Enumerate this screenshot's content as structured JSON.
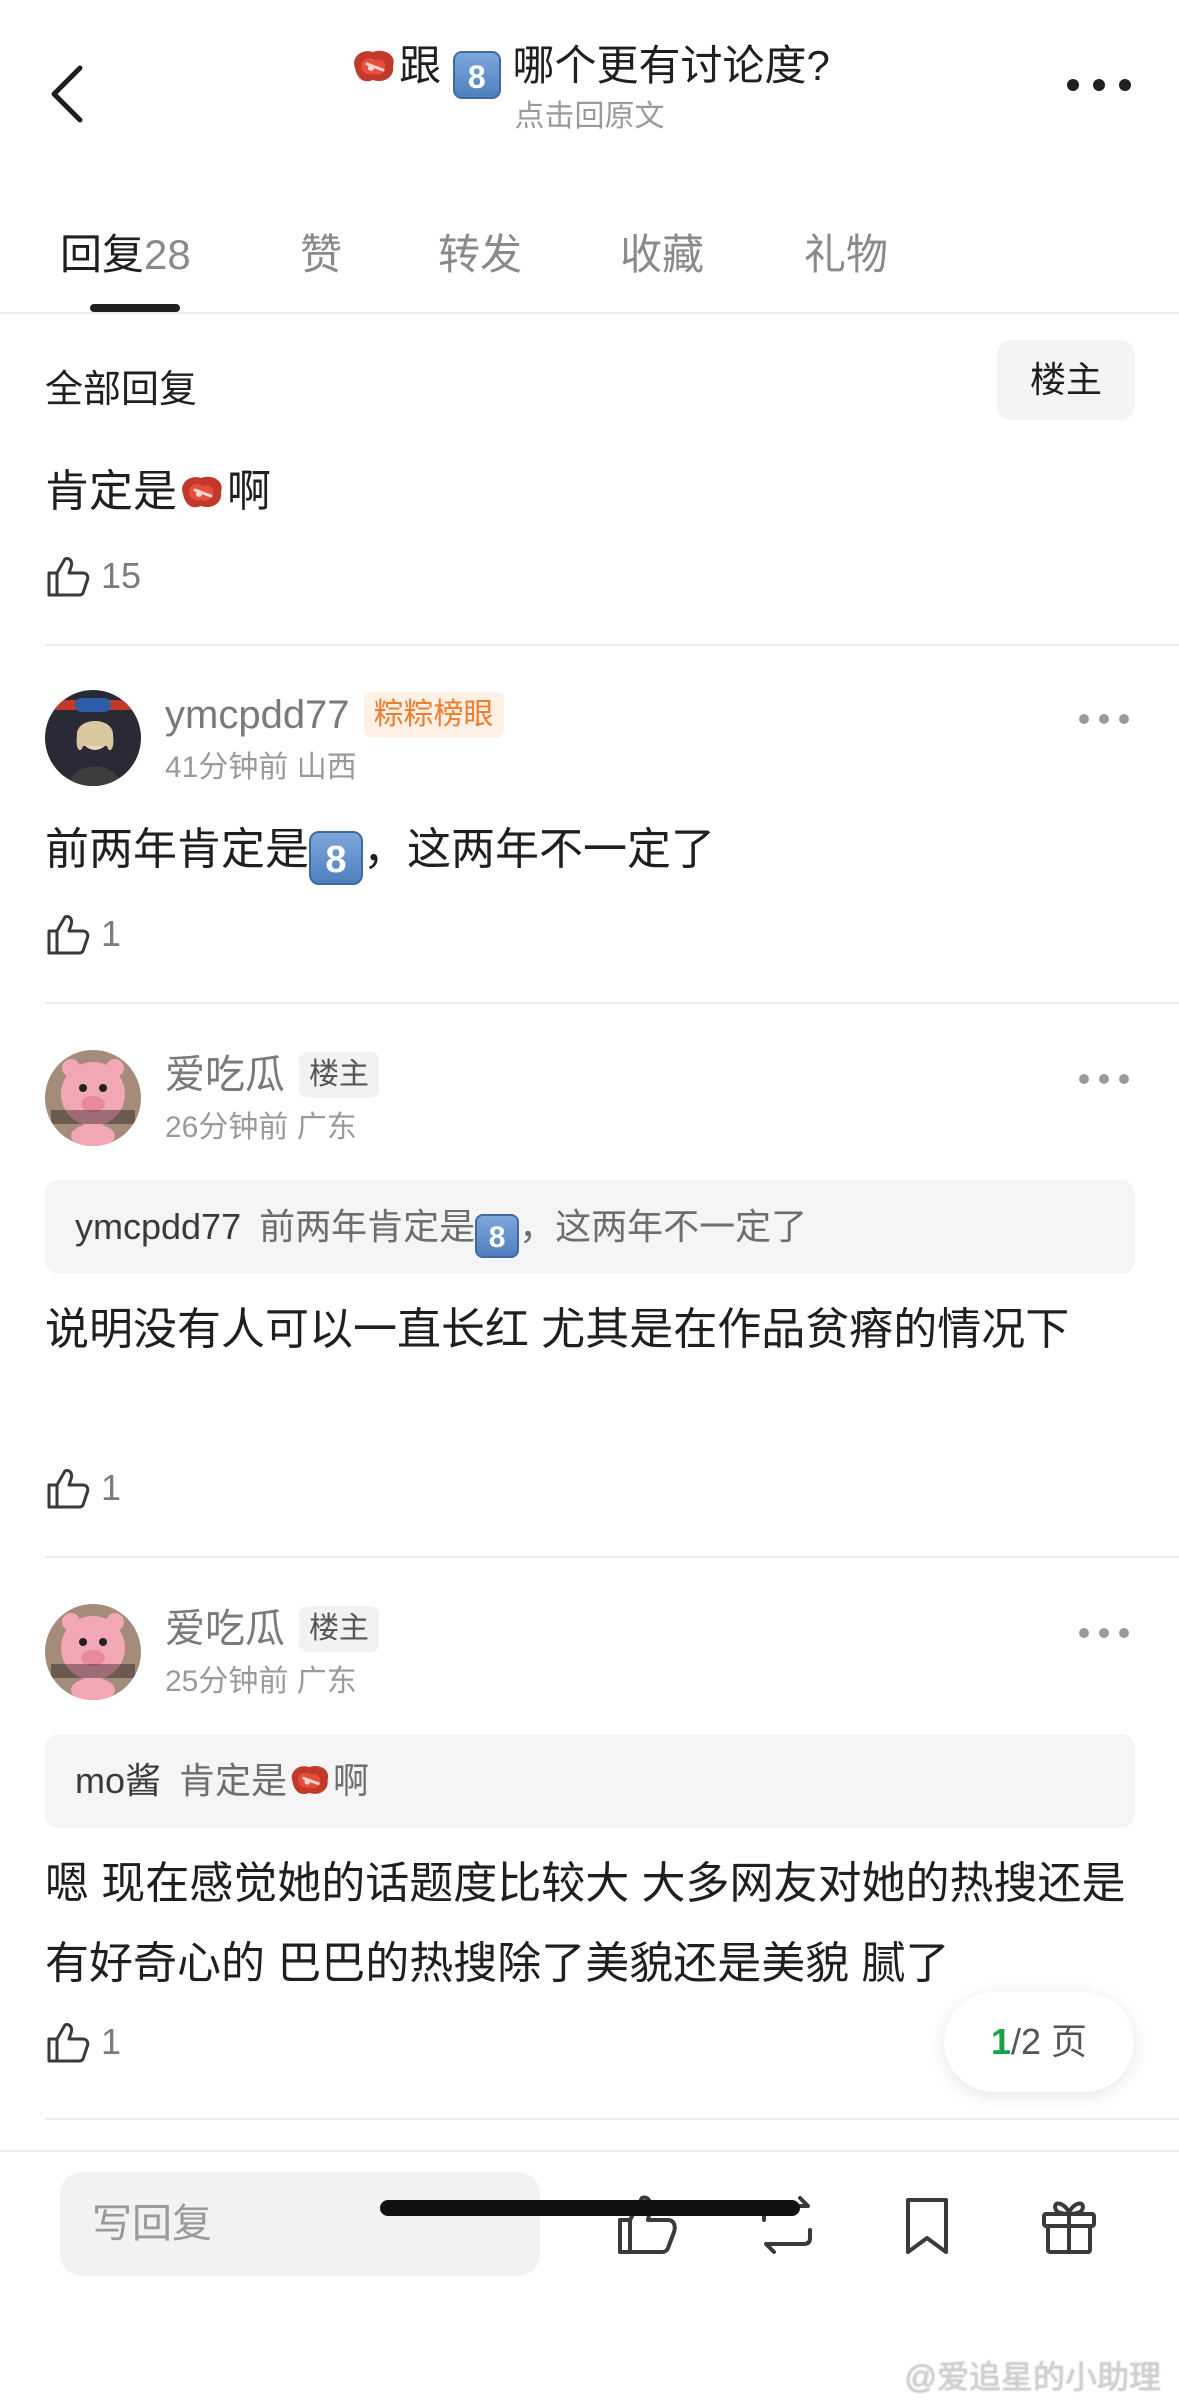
{
  "header": {
    "title_before": "跟",
    "title_after": "哪个更有讨论度?",
    "subtitle": "点击回原文",
    "emoji_8": "8",
    "icons": [
      "chevron-left-icon",
      "more-icon",
      "steak-emoji-icon"
    ]
  },
  "tabs": [
    {
      "label": "回复",
      "count": "28",
      "active": true
    },
    {
      "label": "赞"
    },
    {
      "label": "转发"
    },
    {
      "label": "收藏"
    },
    {
      "label": "礼物"
    }
  ],
  "section": {
    "title": "全部回复",
    "filter_label": "楼主"
  },
  "comments": [
    {
      "text_before": "肯定是",
      "text_after": "啊",
      "likes": "15"
    },
    {
      "user": "ymcpdd77",
      "badge": "粽粽榜眼",
      "time": "41分钟前",
      "location": "山西",
      "text_before": "前两年肯定是",
      "emoji_8": "8",
      "text_after": "，这两年不一定了",
      "likes": "1"
    },
    {
      "user": "爱吃瓜",
      "badge": "楼主",
      "time": "26分钟前",
      "location": "广东",
      "quote_user": "ymcpdd77",
      "quote_text_before": "前两年肯定是",
      "quote_emoji_8": "8",
      "quote_text_after": "，这两年不一定了",
      "text": "说明没有人可以一直长红 尤其是在作品贫瘠的情况下",
      "likes": "1"
    },
    {
      "user": "爱吃瓜",
      "badge": "楼主",
      "time": "25分钟前",
      "location": "广东",
      "quote_user": "mo酱",
      "quote_text_before": "肯定是",
      "quote_text_after": "啊",
      "text": "嗯 现在感觉她的话题度比较大 大多网友对她的热搜还是有好奇心的 巴巴的热搜除了美貌还是美貌  腻了",
      "likes": "1"
    }
  ],
  "pager": {
    "current": "1",
    "rest": "/2 页"
  },
  "bottom": {
    "reply_placeholder": "写回复",
    "icons": [
      "thumb-up-icon",
      "repost-icon",
      "bookmark-icon",
      "gift-icon"
    ]
  },
  "watermark": "@爱追星的小助理",
  "colors": {
    "accent_green": "#16a34a",
    "badge_orange": "#f07c2c",
    "text_primary": "#1f1f1f",
    "text_secondary": "#9a9a9a"
  }
}
